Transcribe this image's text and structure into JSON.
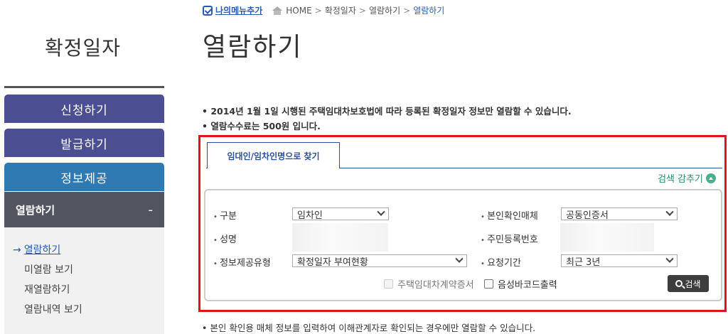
{
  "sidebar": {
    "title": "확정일자",
    "buttons": [
      "신청하기",
      "발급하기",
      "정보제공"
    ],
    "active": {
      "label": "열람하기",
      "toggle": "-"
    },
    "submenu": [
      {
        "label": "열람하기",
        "arrow": "→"
      },
      {
        "label": "미열람 보기"
      },
      {
        "label": "재열람하기"
      },
      {
        "label": "열람내역 보기"
      }
    ]
  },
  "breadcrumb": {
    "favorite": "나의메뉴추가",
    "items": [
      "HOME",
      "확정일자",
      "열람하기",
      "열람하기"
    ],
    "sep": ">"
  },
  "page": {
    "title": "열람하기",
    "notices": [
      "• 2014년 1월 1일 시행된 주택임대차보호법에 따라 등록된 확정일자 정보만 열람할 수 있습니다.",
      "• 열람수수료는 500원 입니다."
    ],
    "bottom_notice": "• 본인 확인용 매체 정보를 입력하여 이해관계자로 확인되는 경우에만 열람할 수 있습니다."
  },
  "search": {
    "tab": "임대인/임차인명으로 찾기",
    "toggle": "검색 감추기",
    "fields": {
      "type": {
        "label": "구분",
        "value": "임차인"
      },
      "auth": {
        "label": "본인확인매체",
        "value": "공동인증서"
      },
      "name": {
        "label": "성명"
      },
      "rrn": {
        "label": "주민등록번호"
      },
      "info_type": {
        "label": "정보제공유형",
        "value": "확정일자 부여현황"
      },
      "period": {
        "label": "요청기간",
        "value": "최근 3년"
      }
    },
    "checkboxes": [
      {
        "label": "주택임대차계약증서",
        "checked": false,
        "disabled": true
      },
      {
        "label": "음성바코드출력",
        "checked": false,
        "disabled": false
      }
    ],
    "button": "검색"
  }
}
